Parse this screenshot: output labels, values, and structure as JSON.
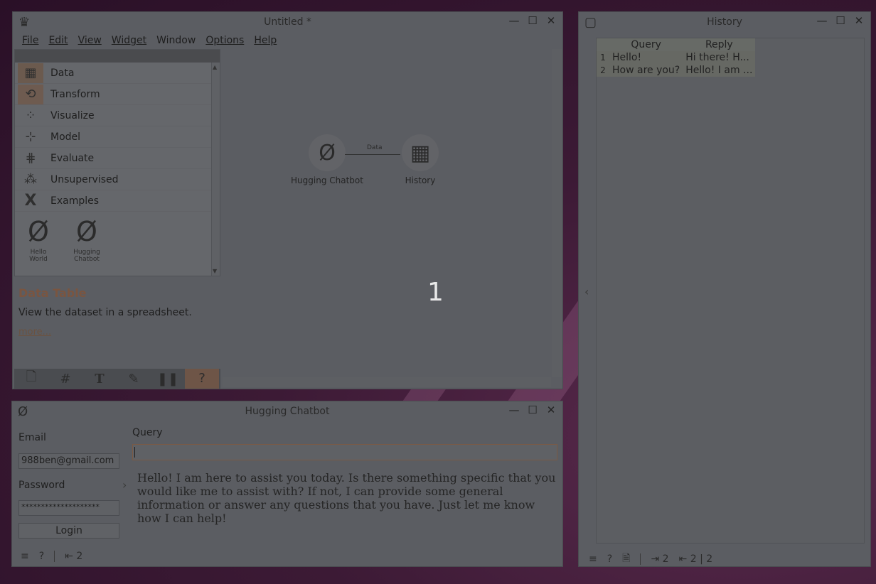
{
  "main_window": {
    "title": "Untitled *",
    "menu": [
      "File",
      "Edit",
      "View",
      "Widget",
      "Window",
      "Options",
      "Help"
    ],
    "categories": [
      {
        "label": "Data",
        "icon": "table-icon"
      },
      {
        "label": "Transform",
        "icon": "transform-icon"
      },
      {
        "label": "Visualize",
        "icon": "scatter-icon"
      },
      {
        "label": "Model",
        "icon": "network-icon"
      },
      {
        "label": "Evaluate",
        "icon": "grid-icon"
      },
      {
        "label": "Unsupervised",
        "icon": "cluster-icon"
      },
      {
        "label": "Examples",
        "icon": "x-icon"
      }
    ],
    "widgets": [
      {
        "glyph": "Ø",
        "label": "Hello World"
      },
      {
        "glyph": "Ø",
        "label": "Hugging Chatbot"
      }
    ],
    "description": {
      "title": "Data Table",
      "text": "View the dataset in a spreadsheet.",
      "more": "more..."
    },
    "canvas": {
      "node_a": {
        "glyph": "Ø",
        "label": "Hugging Chatbot"
      },
      "node_b": {
        "label": "History"
      },
      "link_label": "Data",
      "big_number": "1"
    }
  },
  "history_window": {
    "title": "History",
    "columns": [
      "Query",
      "Reply"
    ],
    "rows": [
      {
        "index": "1",
        "query": "Hello!",
        "reply": "Hi there! H..."
      },
      {
        "index": "2",
        "query": "How are you?",
        "reply": "Hello! I am ..."
      }
    ],
    "status": {
      "in": "2",
      "out": "2 | 2"
    }
  },
  "chatbot_window": {
    "glyph": "Ø",
    "title": "Hugging Chatbot",
    "email_label": "Email",
    "email_value": "988ben@gmail.com",
    "password_label": "Password",
    "password_value": "********************",
    "login_label": "Login",
    "query_label": "Query",
    "query_value": "",
    "reply_text": "Hello! I am here to assist you today. Is there something specific that you would like me to assist with? If not, I can provide some general information or answer any questions that you have. Just let me know how I can help!",
    "status": {
      "out": "2"
    }
  },
  "colors": {
    "accent": "#7a5540",
    "window_bg": "#5b5d62"
  }
}
